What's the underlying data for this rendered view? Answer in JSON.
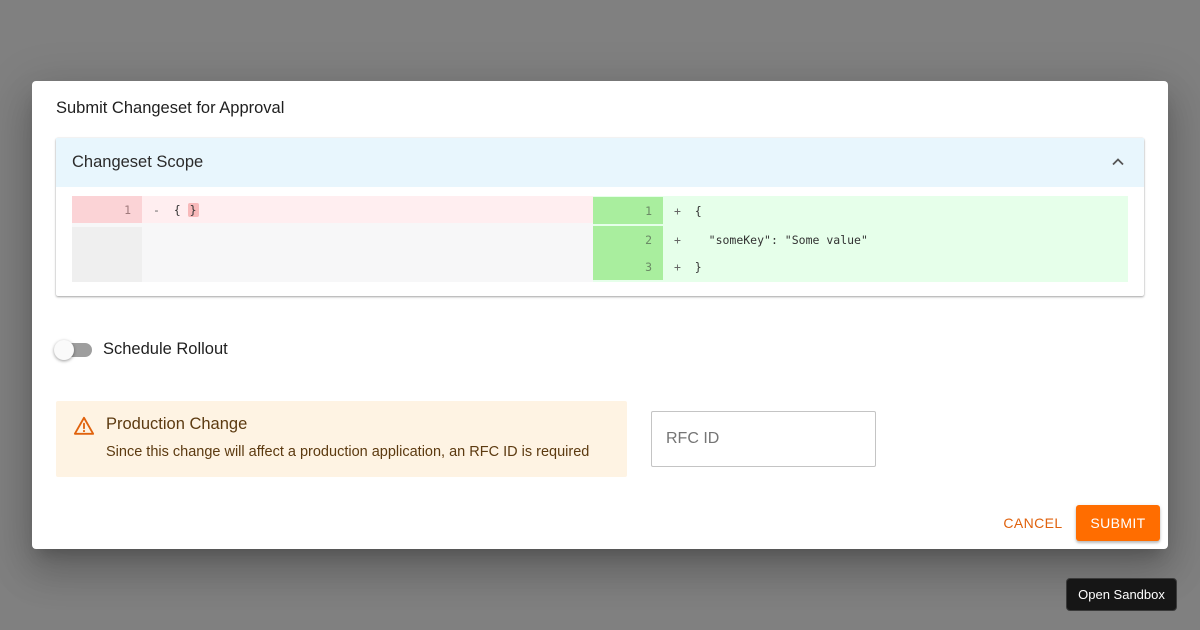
{
  "dialog": {
    "title": "Submit Changeset for Approval"
  },
  "accordion": {
    "title": "Changeset Scope",
    "expanded": true,
    "icon": "chevron-up-icon"
  },
  "diff": {
    "left": [
      {
        "line": "1",
        "prefix": "-",
        "code_before": "{",
        "code_highlight": "}"
      }
    ],
    "right": [
      {
        "line": "1",
        "prefix": "+",
        "code": "{"
      },
      {
        "line": "2",
        "prefix": "+",
        "code": "  \"someKey\": \"Some value\""
      },
      {
        "line": "3",
        "prefix": "+",
        "code": "}"
      }
    ],
    "colors": {
      "deleted_bg": "#ffeef0",
      "added_bg": "#e6ffea"
    }
  },
  "schedule": {
    "label": "Schedule Rollout",
    "enabled": false
  },
  "alert": {
    "icon": "warning-icon",
    "title": "Production Change",
    "message": "Since this change will affect a production application, an RFC ID is required",
    "color": "#fef3e3"
  },
  "rfc": {
    "placeholder": "RFC ID",
    "value": ""
  },
  "actions": {
    "cancel_label": "CANCEL",
    "submit_label": "SUBMIT",
    "accent": "#ff6d00"
  },
  "sandbox": {
    "label": "Open Sandbox"
  }
}
